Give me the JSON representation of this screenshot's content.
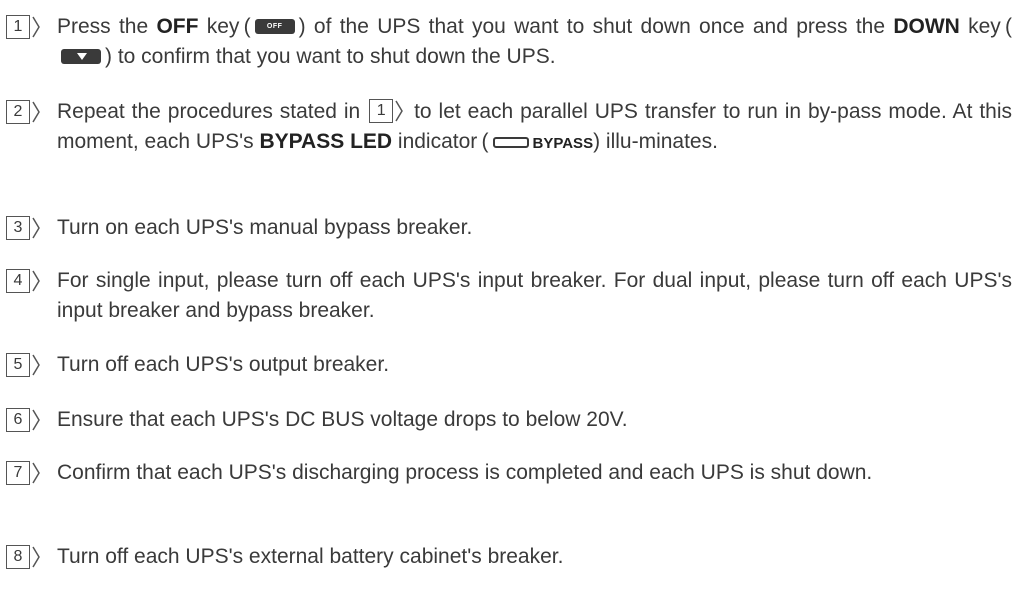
{
  "steps": [
    {
      "num": "1",
      "parts": {
        "a": "Press the ",
        "b": "OFF",
        "c": " key (",
        "key_label": "OFF",
        "d": ") of the UPS that you want to shut down once and press the ",
        "e": "DOWN",
        "f": " key (",
        "g": ") to confirm that you want to shut down the UPS."
      }
    },
    {
      "num": "2",
      "parts": {
        "a": "Repeat the procedures stated in ",
        "ref": "1",
        "b": " to let each parallel UPS transfer to run in by-pass mode. At this moment, each UPS's ",
        "c": "BYPASS LED",
        "d": " indicator (",
        "led_label": "BYPASS",
        "e": ") illu-minates."
      }
    },
    {
      "num": "3",
      "text": "Turn on each UPS's manual bypass breaker."
    },
    {
      "num": "4",
      "text": "For single input, please turn off each UPS's input breaker. For dual input, please turn off each UPS's input breaker and bypass breaker."
    },
    {
      "num": "5",
      "text": "Turn off each UPS's output breaker."
    },
    {
      "num": "6",
      "text": "Ensure that each UPS's DC BUS voltage drops to below 20V."
    },
    {
      "num": "7",
      "text": "Confirm that each UPS's discharging process is completed and each UPS is shut down."
    },
    {
      "num": "8",
      "text": "Turn off each UPS's external battery cabinet's breaker."
    }
  ]
}
